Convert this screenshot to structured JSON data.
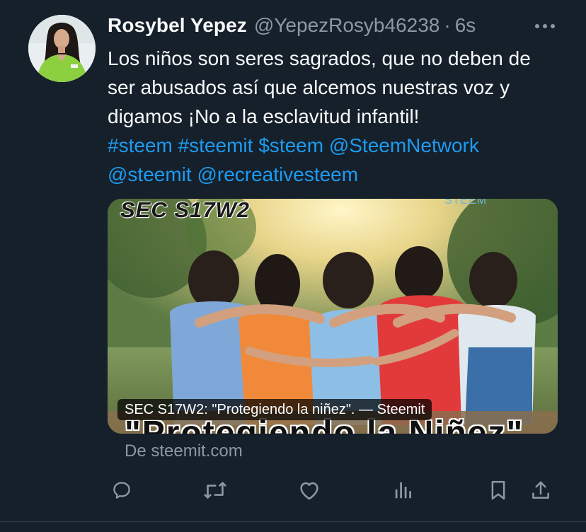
{
  "tweet": {
    "author_name": "Rosybel Yepez",
    "author_handle": "@YepezRosyb46238",
    "separator": "·",
    "time": "6s",
    "text_plain": "Los niños son seres sagrados, que no deben de ser abusados así que alcemos nuestras voz y digamos ¡No a la esclavitud infantil!",
    "tags": [
      "#steem",
      "#steemit",
      "$steem",
      "@SteemNetwork",
      "@steemit",
      "@recreativesteem"
    ]
  },
  "card": {
    "overlay_title": "SEC S17W2: \"Protegiendo la niñez\". — Steemit",
    "image_top_text": "SEC S17W2",
    "image_bottom_text": "\"Protegiendo la Niñez\"",
    "image_watermark": "STEEM",
    "source": "De steemit.com"
  },
  "icons": {
    "more": "more-horizontal-icon",
    "reply": "reply-icon",
    "retweet": "retweet-icon",
    "like": "heart-icon",
    "views": "analytics-icon",
    "bookmark": "bookmark-icon",
    "share": "share-icon"
  },
  "colors": {
    "background": "#15202b",
    "text_primary": "#f7f9f9",
    "text_secondary": "#8b98a5",
    "link": "#1d9bf0",
    "divider": "#38444d"
  }
}
